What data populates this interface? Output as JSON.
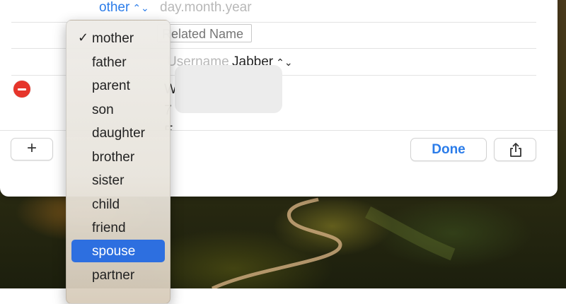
{
  "fields": {
    "date_label": "other",
    "date_placeholder": "day.month.year",
    "related_name_placeholder": "Related Name",
    "username_placeholder": "Username",
    "service": "Jabber",
    "partial_lines": [
      "W",
      "7",
      "E"
    ]
  },
  "buttons": {
    "add": "+",
    "done": "Done",
    "share_icon": "share-icon"
  },
  "menu": {
    "items": [
      {
        "label": "mother",
        "checked": true
      },
      {
        "label": "father"
      },
      {
        "label": "parent"
      },
      {
        "label": "son"
      },
      {
        "label": "daughter"
      },
      {
        "label": "brother"
      },
      {
        "label": "sister"
      },
      {
        "label": "child"
      },
      {
        "label": "friend"
      },
      {
        "label": "spouse",
        "highlighted": true
      },
      {
        "label": "partner"
      }
    ],
    "check_glyph": "✓"
  },
  "colors": {
    "accent": "#2b7ce9",
    "highlight": "#2d6fe0",
    "remove": "#e6352b"
  }
}
